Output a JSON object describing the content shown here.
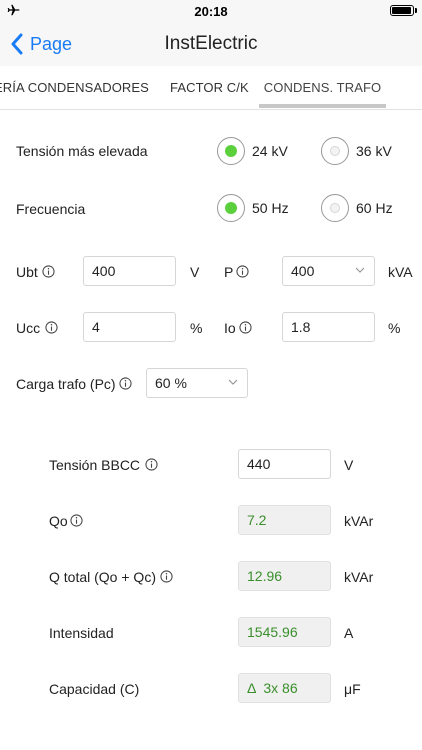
{
  "status_bar": {
    "time": "20:18",
    "battery_level": 0.95
  },
  "nav": {
    "back_label": "Page",
    "title": "InstElectric"
  },
  "tabs": [
    {
      "label": "ERÍA CONDENSADORES",
      "active": false
    },
    {
      "label": "FACTOR C/K",
      "active": false
    },
    {
      "label": "CONDENS. TRAFO",
      "active": true
    }
  ],
  "form": {
    "tension": {
      "label": "Tensión más elevada",
      "options": [
        {
          "label": "24 kV",
          "selected": true
        },
        {
          "label": "36 kV",
          "selected": false
        }
      ]
    },
    "frecuencia": {
      "label": "Frecuencia",
      "options": [
        {
          "label": "50 Hz",
          "selected": true
        },
        {
          "label": "60 Hz",
          "selected": false
        }
      ]
    },
    "ubt": {
      "label": "Ubt",
      "value": "400",
      "unit": "V"
    },
    "p": {
      "label": "P",
      "value": "400",
      "unit": "kVA"
    },
    "ucc": {
      "label": "Ucc",
      "value": "4",
      "unit": "%"
    },
    "io": {
      "label": "Io",
      "value": "1.8",
      "unit": "%"
    },
    "carga": {
      "label": "Carga trafo (Pc)",
      "value": "60 %"
    }
  },
  "results": {
    "tension_bbcc": {
      "label": "Tensión BBCC",
      "value": "440",
      "unit": "V"
    },
    "qo": {
      "label": "Qo",
      "value": "7.2",
      "unit": "kVAr"
    },
    "qtotal": {
      "label": "Q total (Qo + Qc)",
      "value": "12.96",
      "unit": "kVAr"
    },
    "intensidad": {
      "label": "Intensidad",
      "value": "1545.96",
      "unit": "A"
    },
    "capacidad": {
      "label": "Capacidad (C)",
      "value": "Δ  3x 86",
      "unit": "μF"
    }
  }
}
